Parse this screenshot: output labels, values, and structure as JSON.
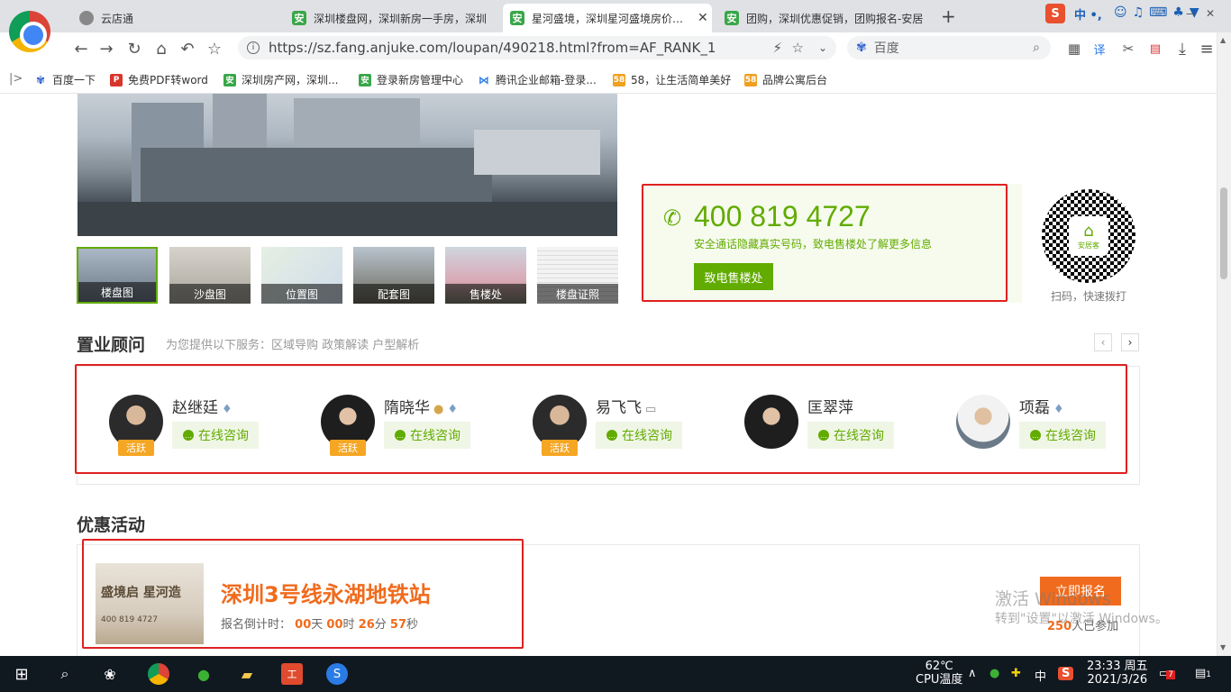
{
  "browser": {
    "tabs": [
      {
        "label": "云店通",
        "active": false
      },
      {
        "label": "深圳楼盘网，深圳新房一手房，深圳",
        "active": false
      },
      {
        "label": "星河盛境，深圳星河盛境房价，星",
        "active": true
      },
      {
        "label": "团购，深圳优惠促销，团购报名-安居",
        "active": false
      }
    ],
    "new_tab": "+",
    "url": "https://sz.fang.anjuke.com/loupan/490218.html?from=AF_RANK_1",
    "search_engine": "百度",
    "bookmarks": [
      "百度一下",
      "免费PDF转word",
      "深圳房产网，深圳...",
      "登录新房管理中心",
      "腾讯企业邮箱-登录...",
      "58，让生活简单美好",
      "品牌公寓后台"
    ],
    "sogou_toolbar": "中 •,"
  },
  "gallery": {
    "thumbs": [
      "楼盘图",
      "沙盘图",
      "位置图",
      "配套图",
      "售楼处",
      "楼盘证照"
    ]
  },
  "phone": {
    "number": "400 819 4727",
    "tip": "安全通话隐藏真实号码，致电售楼处了解更多信息",
    "button": "致电售楼处",
    "qr_caption": "扫码，快速拨打",
    "qr_logo": "安居客"
  },
  "advisors": {
    "title": "置业顾问",
    "subtitle": "为您提供以下服务：区域导购 政策解读 户型解析",
    "chat_label": "在线咨询",
    "active_label": "活跃",
    "list": [
      {
        "name": "赵继廷",
        "active": true
      },
      {
        "name": "隋晓华",
        "active": true
      },
      {
        "name": "易飞飞",
        "active": true
      },
      {
        "name": "匡翠萍",
        "active": false
      },
      {
        "name": "项磊",
        "active": false
      }
    ]
  },
  "promo": {
    "title": "优惠活动",
    "image_text": "盛境启 星河造",
    "image_phone": "400 819 4727",
    "name": "深圳3号线永湖地铁站",
    "countdown_label": "报名倒计时：",
    "days": "00",
    "days_unit": "天",
    "hours": "00",
    "hours_unit": "时",
    "minutes": "26",
    "minutes_unit": "分",
    "seconds": "57",
    "seconds_unit": "秒",
    "signup": "立即报名",
    "signup_count": "250",
    "signup_suffix": "人已参加"
  },
  "watermark": {
    "line1": "激活 Windows",
    "line2": "转到\"设置\"以激活 Windows。"
  },
  "taskbar": {
    "temp": "62℃",
    "temp_label": "CPU温度",
    "ime": "中",
    "time": "23:33 周五",
    "date": "2021/3/26",
    "notif_count": "7",
    "action_count": "1"
  },
  "colors": {
    "brand_green": "#62ab00",
    "promo_orange": "#f06b1d",
    "highlight_red": "#e02020"
  }
}
